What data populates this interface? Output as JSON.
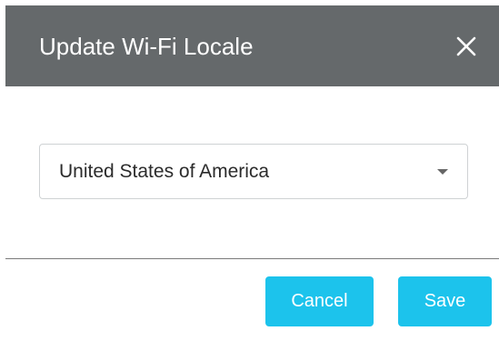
{
  "dialog": {
    "title": "Update Wi-Fi Locale",
    "close_icon": "close-icon"
  },
  "locale_select": {
    "selected": "United States of America",
    "icon": "chevron-down-icon"
  },
  "footer": {
    "cancel_label": "Cancel",
    "save_label": "Save"
  },
  "colors": {
    "header_bg": "#65696b",
    "button_bg": "#1cc3ec",
    "button_text": "#ffffff"
  }
}
